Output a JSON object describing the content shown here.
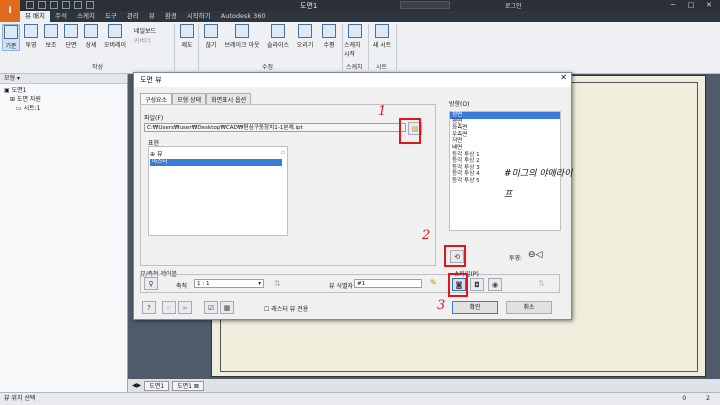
{
  "titlebar": {
    "logo": "I",
    "title": "도면1",
    "user": "로그인",
    "winbtns": [
      "─",
      "□",
      "✕"
    ]
  },
  "menu_tabs": [
    {
      "label": "뷰 배치",
      "active": true
    },
    {
      "label": "주석"
    },
    {
      "label": "스케치"
    },
    {
      "label": "도구"
    },
    {
      "label": "관리"
    },
    {
      "label": "뷰"
    },
    {
      "label": "환경"
    },
    {
      "label": "시작하기"
    },
    {
      "label": "Autodesk 360"
    }
  ],
  "ribbon": {
    "buttons": [
      "기준",
      "투영",
      "보조",
      "단면",
      "상세",
      "오버레이",
      "네일보드",
      "커버더",
      "제도",
      "끊기",
      "브레이크 아웃",
      "슬라이스",
      "오리기",
      "수평",
      "스케치 시작",
      "새 시트"
    ],
    "groups": [
      "작성",
      "수정",
      "스케치",
      "시트"
    ]
  },
  "left_panel": {
    "header": "모형 ▾",
    "tree": [
      "도면1",
      "도면 자원",
      "시트:1"
    ]
  },
  "bottom_tabs": {
    "tab1": "도면1",
    "tab2": "도면1 ⊠"
  },
  "statusbar": {
    "text": "뷰 위치 선택",
    "n1": "0",
    "n2": "2"
  },
  "dialog": {
    "title": "도면 뷰",
    "close": "✕",
    "tabs": [
      "구성요소",
      "모형 상태",
      "화면표시 옵션"
    ],
    "file_label": "파일(F)",
    "file_path": "C:₩Users₩user₩Desktop₩CAD₩편심구동장치1-1본체.ipt",
    "repr_label": "표현",
    "view_label": "뷰",
    "view_list": [
      "마스터"
    ],
    "orientation_label": "방향(O)",
    "orientation_list": [
      "정면",
      "평면",
      "좌측면",
      "우측면",
      "저면",
      "배면",
      "등각 투상 1",
      "등각 투상 2",
      "등각 투상 3",
      "등각 투상 4",
      "등각 투상 5"
    ],
    "projection_label": "투영:",
    "scale_section": "뷰/축척 레이블",
    "scale_label": "축척",
    "scale_value": "1 : 1",
    "view_id_label": "뷰 식별자",
    "view_id_value": "#1",
    "style_label": "스타일(P)",
    "raster_label": "래스터 뷰 전용",
    "ok": "확인",
    "cancel": "취소"
  },
  "annotations": {
    "n1": "1",
    "n2": "2",
    "n3": "3",
    "handwritten": "#미그의 야매라이프",
    "color": "#e0171d"
  }
}
